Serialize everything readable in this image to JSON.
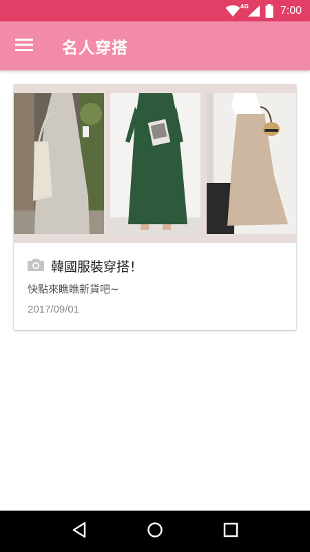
{
  "status_bar": {
    "network": "4G",
    "time": "7:00",
    "icons": [
      "wifi-icon",
      "cell-signal-icon",
      "battery-icon"
    ]
  },
  "app_bar": {
    "title": "名人穿搭",
    "menu_icon": "hamburger-menu-icon"
  },
  "card": {
    "icon": "camera-icon",
    "title": "韓國服裝穿搭！",
    "subtitle": "快點來瞧瞧新貨吧~",
    "date": "2017/09/01"
  },
  "nav_bar": {
    "icons": [
      "back-icon",
      "home-icon",
      "recents-icon"
    ]
  },
  "colors": {
    "status_bar": "#e23e66",
    "app_bar": "#f28ba8",
    "nav_bar": "#000000"
  }
}
